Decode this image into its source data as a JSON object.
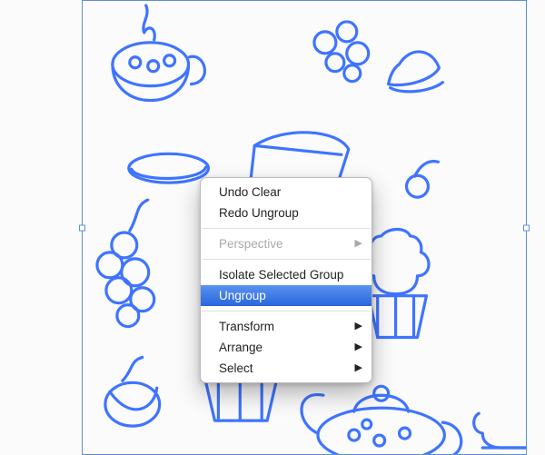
{
  "artwork": {
    "selection_stroke": "#3e74ff",
    "selection_bbox": "#5b90d4"
  },
  "context_menu": {
    "items": [
      {
        "id": "undo",
        "label": "Undo Clear",
        "disabled": false,
        "submenu": false,
        "highlighted": false
      },
      {
        "id": "redo",
        "label": "Redo Ungroup",
        "disabled": false,
        "submenu": false,
        "highlighted": false
      },
      {
        "sep": true
      },
      {
        "id": "perspective",
        "label": "Perspective",
        "disabled": true,
        "submenu": true,
        "highlighted": false
      },
      {
        "sep": true
      },
      {
        "id": "isolate",
        "label": "Isolate Selected Group",
        "disabled": false,
        "submenu": false,
        "highlighted": false
      },
      {
        "id": "ungroup",
        "label": "Ungroup",
        "disabled": false,
        "submenu": false,
        "highlighted": true
      },
      {
        "sep": true
      },
      {
        "id": "transform",
        "label": "Transform",
        "disabled": false,
        "submenu": true,
        "highlighted": false
      },
      {
        "id": "arrange",
        "label": "Arrange",
        "disabled": false,
        "submenu": true,
        "highlighted": false
      },
      {
        "id": "select",
        "label": "Select",
        "disabled": false,
        "submenu": true,
        "highlighted": false
      }
    ]
  }
}
